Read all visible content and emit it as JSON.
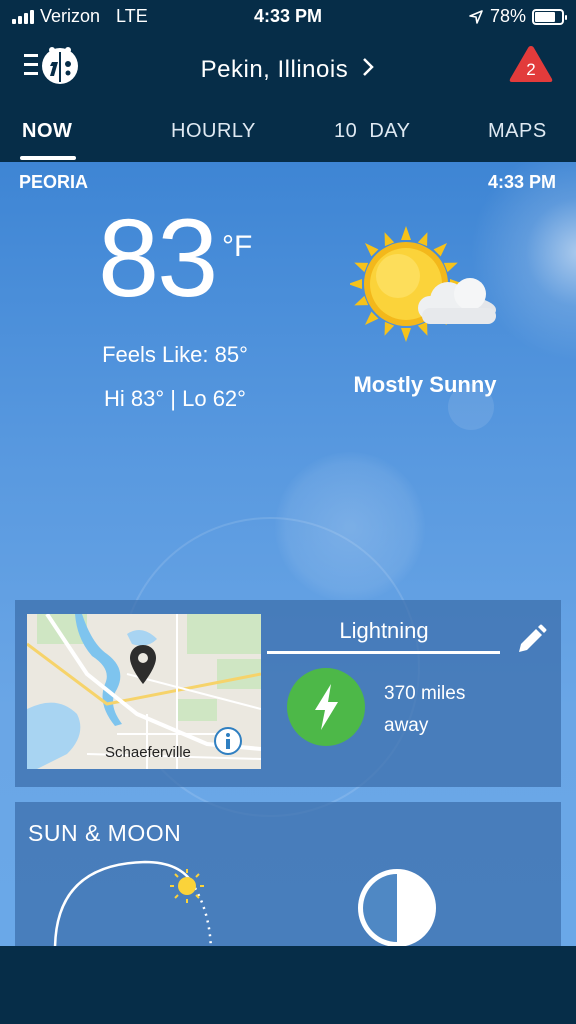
{
  "status_bar": {
    "carrier": "Verizon",
    "network": "LTE",
    "time": "4:33 PM",
    "battery": "78%",
    "battery_level": 0.78
  },
  "header": {
    "location": "Pekin, Illinois",
    "alert_count": "2"
  },
  "tabs": [
    {
      "label": "NOW",
      "active": true
    },
    {
      "label": "HOURLY",
      "active": false
    },
    {
      "label": "10  DAY",
      "active": false
    },
    {
      "label": "MAPS",
      "active": false
    }
  ],
  "current": {
    "station": "PEORIA",
    "time": "4:33 PM",
    "temperature": "83",
    "unit": "°F",
    "feels_like": "Feels Like: 85°",
    "hi_lo": "Hi 83° | Lo 62°",
    "condition": "Mostly Sunny",
    "condition_icon": "sun-cloud-icon"
  },
  "lightning": {
    "title": "Lightning",
    "distance_line1": "370 miles",
    "distance_line2": "away",
    "map_label": "Schaeferville"
  },
  "sun_moon": {
    "title": "SUN & MOON"
  },
  "colors": {
    "nav_bg": "#062d48",
    "alert": "#e23b3b",
    "lightning_green": "#4db848",
    "sun": "#fbd33a"
  }
}
